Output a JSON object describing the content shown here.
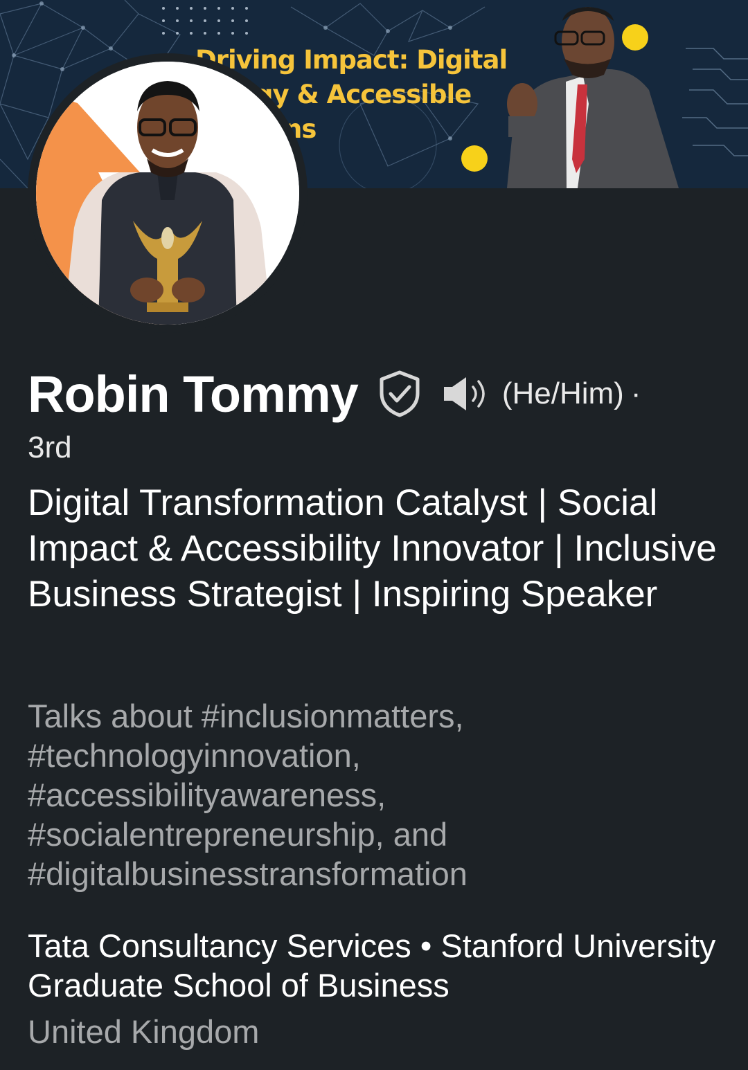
{
  "banner": {
    "title_line1": "Driving Impact: Digital",
    "title_line2": "gy & Accessible",
    "title_line3": "ns",
    "accent_color": "#f6c43b"
  },
  "profile": {
    "name": "Robin Tommy",
    "pronouns": "(He/Him)",
    "separator": "·",
    "degree": "3rd",
    "headline": "Digital Transformation Catalyst | Social Impact & Accessibility Innovator | Inclusive Business Strategist | Inspiring Speaker",
    "talks_about": "Talks about #inclusionmatters, #technologyinnovation, #accessibilityawareness, #socialentrepreneurship, and #digitalbusinesstransformation",
    "education_line": "Tata Consultancy Services • Stanford University Graduate School of Business",
    "location": "United Kingdom"
  },
  "icons": {
    "verified": "shield-check-icon",
    "pronunciation": "speaker-icon"
  }
}
